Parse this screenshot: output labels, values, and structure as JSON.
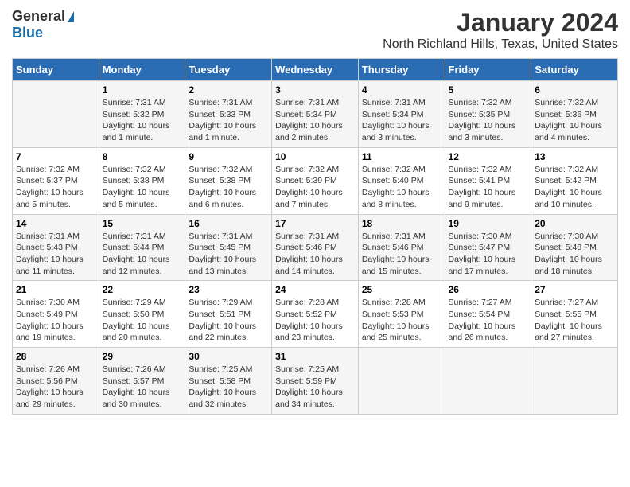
{
  "logo": {
    "general": "General",
    "blue": "Blue"
  },
  "title": "January 2024",
  "subtitle": "North Richland Hills, Texas, United States",
  "header": {
    "days": [
      "Sunday",
      "Monday",
      "Tuesday",
      "Wednesday",
      "Thursday",
      "Friday",
      "Saturday"
    ]
  },
  "weeks": [
    {
      "cells": [
        {
          "day": null,
          "num": null,
          "sunrise": null,
          "sunset": null,
          "daylight": null
        },
        {
          "day": "Monday",
          "num": "1",
          "sunrise": "7:31 AM",
          "sunset": "5:32 PM",
          "daylight": "10 hours and 1 minute."
        },
        {
          "day": "Tuesday",
          "num": "2",
          "sunrise": "7:31 AM",
          "sunset": "5:33 PM",
          "daylight": "10 hours and 1 minute."
        },
        {
          "day": "Wednesday",
          "num": "3",
          "sunrise": "7:31 AM",
          "sunset": "5:34 PM",
          "daylight": "10 hours and 2 minutes."
        },
        {
          "day": "Thursday",
          "num": "4",
          "sunrise": "7:31 AM",
          "sunset": "5:34 PM",
          "daylight": "10 hours and 3 minutes."
        },
        {
          "day": "Friday",
          "num": "5",
          "sunrise": "7:32 AM",
          "sunset": "5:35 PM",
          "daylight": "10 hours and 3 minutes."
        },
        {
          "day": "Saturday",
          "num": "6",
          "sunrise": "7:32 AM",
          "sunset": "5:36 PM",
          "daylight": "10 hours and 4 minutes."
        }
      ]
    },
    {
      "cells": [
        {
          "day": "Sunday",
          "num": "7",
          "sunrise": "7:32 AM",
          "sunset": "5:37 PM",
          "daylight": "10 hours and 5 minutes."
        },
        {
          "day": "Monday",
          "num": "8",
          "sunrise": "7:32 AM",
          "sunset": "5:38 PM",
          "daylight": "10 hours and 5 minutes."
        },
        {
          "day": "Tuesday",
          "num": "9",
          "sunrise": "7:32 AM",
          "sunset": "5:38 PM",
          "daylight": "10 hours and 6 minutes."
        },
        {
          "day": "Wednesday",
          "num": "10",
          "sunrise": "7:32 AM",
          "sunset": "5:39 PM",
          "daylight": "10 hours and 7 minutes."
        },
        {
          "day": "Thursday",
          "num": "11",
          "sunrise": "7:32 AM",
          "sunset": "5:40 PM",
          "daylight": "10 hours and 8 minutes."
        },
        {
          "day": "Friday",
          "num": "12",
          "sunrise": "7:32 AM",
          "sunset": "5:41 PM",
          "daylight": "10 hours and 9 minutes."
        },
        {
          "day": "Saturday",
          "num": "13",
          "sunrise": "7:32 AM",
          "sunset": "5:42 PM",
          "daylight": "10 hours and 10 minutes."
        }
      ]
    },
    {
      "cells": [
        {
          "day": "Sunday",
          "num": "14",
          "sunrise": "7:31 AM",
          "sunset": "5:43 PM",
          "daylight": "10 hours and 11 minutes."
        },
        {
          "day": "Monday",
          "num": "15",
          "sunrise": "7:31 AM",
          "sunset": "5:44 PM",
          "daylight": "10 hours and 12 minutes."
        },
        {
          "day": "Tuesday",
          "num": "16",
          "sunrise": "7:31 AM",
          "sunset": "5:45 PM",
          "daylight": "10 hours and 13 minutes."
        },
        {
          "day": "Wednesday",
          "num": "17",
          "sunrise": "7:31 AM",
          "sunset": "5:46 PM",
          "daylight": "10 hours and 14 minutes."
        },
        {
          "day": "Thursday",
          "num": "18",
          "sunrise": "7:31 AM",
          "sunset": "5:46 PM",
          "daylight": "10 hours and 15 minutes."
        },
        {
          "day": "Friday",
          "num": "19",
          "sunrise": "7:30 AM",
          "sunset": "5:47 PM",
          "daylight": "10 hours and 17 minutes."
        },
        {
          "day": "Saturday",
          "num": "20",
          "sunrise": "7:30 AM",
          "sunset": "5:48 PM",
          "daylight": "10 hours and 18 minutes."
        }
      ]
    },
    {
      "cells": [
        {
          "day": "Sunday",
          "num": "21",
          "sunrise": "7:30 AM",
          "sunset": "5:49 PM",
          "daylight": "10 hours and 19 minutes."
        },
        {
          "day": "Monday",
          "num": "22",
          "sunrise": "7:29 AM",
          "sunset": "5:50 PM",
          "daylight": "10 hours and 20 minutes."
        },
        {
          "day": "Tuesday",
          "num": "23",
          "sunrise": "7:29 AM",
          "sunset": "5:51 PM",
          "daylight": "10 hours and 22 minutes."
        },
        {
          "day": "Wednesday",
          "num": "24",
          "sunrise": "7:28 AM",
          "sunset": "5:52 PM",
          "daylight": "10 hours and 23 minutes."
        },
        {
          "day": "Thursday",
          "num": "25",
          "sunrise": "7:28 AM",
          "sunset": "5:53 PM",
          "daylight": "10 hours and 25 minutes."
        },
        {
          "day": "Friday",
          "num": "26",
          "sunrise": "7:27 AM",
          "sunset": "5:54 PM",
          "daylight": "10 hours and 26 minutes."
        },
        {
          "day": "Saturday",
          "num": "27",
          "sunrise": "7:27 AM",
          "sunset": "5:55 PM",
          "daylight": "10 hours and 27 minutes."
        }
      ]
    },
    {
      "cells": [
        {
          "day": "Sunday",
          "num": "28",
          "sunrise": "7:26 AM",
          "sunset": "5:56 PM",
          "daylight": "10 hours and 29 minutes."
        },
        {
          "day": "Monday",
          "num": "29",
          "sunrise": "7:26 AM",
          "sunset": "5:57 PM",
          "daylight": "10 hours and 30 minutes."
        },
        {
          "day": "Tuesday",
          "num": "30",
          "sunrise": "7:25 AM",
          "sunset": "5:58 PM",
          "daylight": "10 hours and 32 minutes."
        },
        {
          "day": "Wednesday",
          "num": "31",
          "sunrise": "7:25 AM",
          "sunset": "5:59 PM",
          "daylight": "10 hours and 34 minutes."
        },
        {
          "day": null,
          "num": null,
          "sunrise": null,
          "sunset": null,
          "daylight": null
        },
        {
          "day": null,
          "num": null,
          "sunrise": null,
          "sunset": null,
          "daylight": null
        },
        {
          "day": null,
          "num": null,
          "sunrise": null,
          "sunset": null,
          "daylight": null
        }
      ]
    }
  ]
}
